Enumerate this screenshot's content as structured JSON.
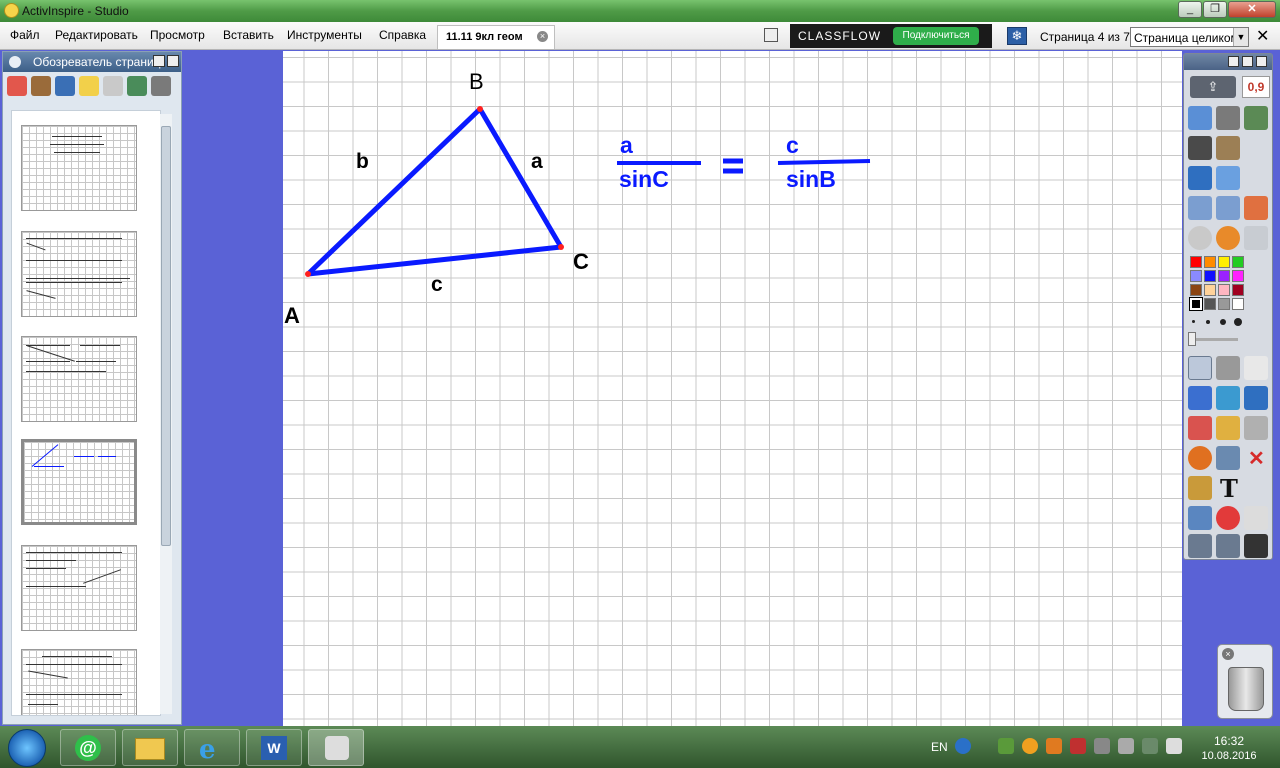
{
  "window": {
    "title": "ActivInspire - Studio"
  },
  "menu": [
    "Файл",
    "Редактировать",
    "Просмотр",
    "Вставить",
    "Инструменты",
    "Справка"
  ],
  "document_tab": "11.11 9кл геом",
  "classflow": {
    "brand": "CLASSFLOW",
    "connect_label": "Подключиться"
  },
  "page_info": "Страница 4 из 7",
  "zoom": "Страница целиком",
  "browser": {
    "title": "Обозреватель страниц"
  },
  "canvas": {
    "vertex_a": "A",
    "vertex_b": "B",
    "vertex_c": "C",
    "side_a": "a",
    "side_b": "b",
    "side_c": "c",
    "formula": {
      "left_num": "a",
      "left_den": "sinC",
      "right_num": "c",
      "right_den": "sinB"
    }
  },
  "toolbox": {
    "pen_width": "0,9"
  },
  "taskbar": {
    "lang": "EN",
    "time": "16:32",
    "date": "10.08.2016"
  },
  "colors": {
    "accent": "#0a1aff",
    "palette": [
      "#ff0000",
      "#ff8c00",
      "#ffee00",
      "#22cc22",
      "#8a8aff",
      "#1010ff",
      "#9a22ff",
      "#ff22ff",
      "#8b4513",
      "#ffd39b",
      "#ffb6c1",
      "#a00020",
      "#000000",
      "#555555",
      "#999999",
      "#ffffff"
    ]
  }
}
